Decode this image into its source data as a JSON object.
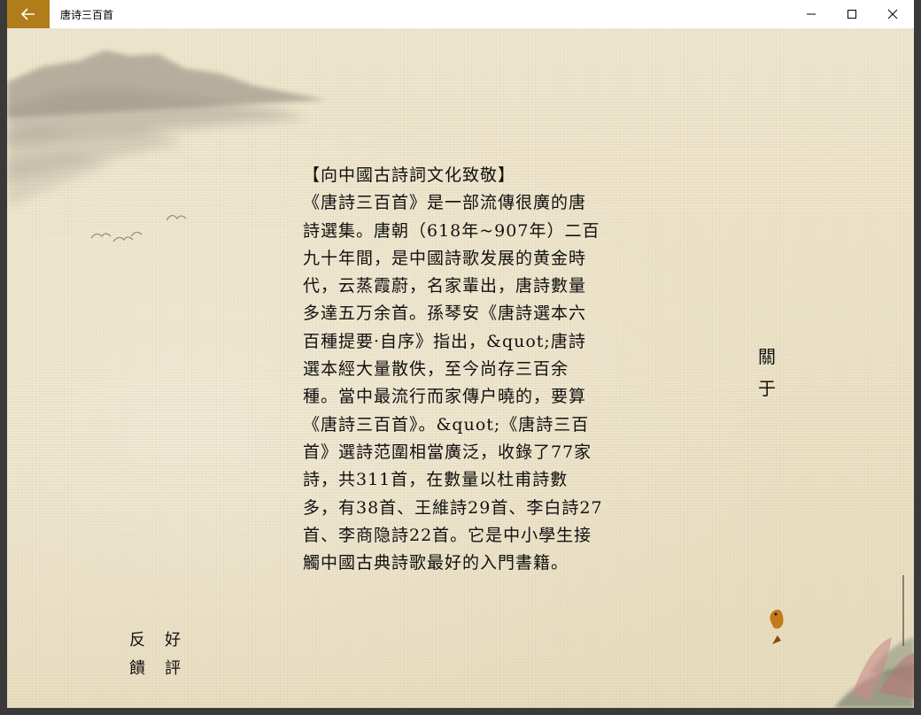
{
  "window": {
    "title": "唐诗三百首",
    "accent": "#b07d1a"
  },
  "content": {
    "poem_lines": [
      "【向中國古詩詞文化致敬】",
      "《唐詩三百首》是一部流傳很廣的唐",
      "詩選集。唐朝（618年~907年）二百",
      "九十年間，是中國詩歌发展的黄金時",
      "代，云蒸霞蔚，名家輩出，唐詩數量",
      "多達五万余首。孫琴安《唐詩選本六",
      "百種提要·自序》指出，&quot;唐詩",
      "選本經大量散佚，至今尚存三百余",
      "種。當中最流行而家傳户曉的，要算",
      "《唐詩三百首》。&quot;《唐詩三百",
      "首》選詩范圍相當廣泛，收錄了77家",
      "詩，共311首，在數量以杜甫詩數",
      "多，有38首、王維詩29首、李白詩27",
      "首、李商隐詩22首。它是中小學生接",
      "觸中國古典詩歌最好的入門書籍。"
    ],
    "about": {
      "char1": "關",
      "char2": "于"
    },
    "feedback": {
      "c1": "反",
      "c2": "好",
      "c3": "饋",
      "c4": "評"
    }
  }
}
